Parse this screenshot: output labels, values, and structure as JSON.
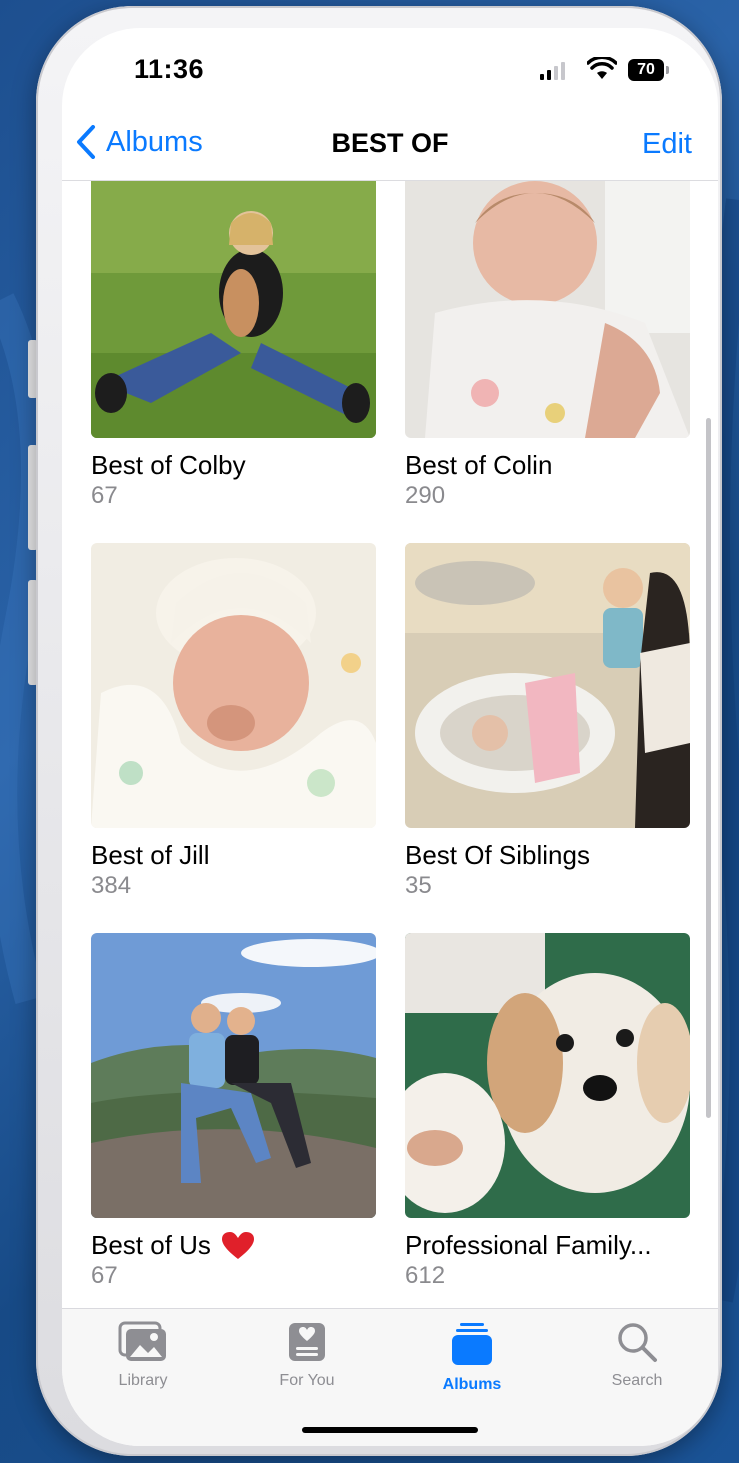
{
  "statusbar": {
    "time": "11:36",
    "battery": "70"
  },
  "nav": {
    "back_label": "Albums",
    "title": "BEST OF",
    "edit_label": "Edit"
  },
  "albums": [
    {
      "name": "Best of Colby",
      "count": "67"
    },
    {
      "name": "Best of Colin",
      "count": "290"
    },
    {
      "name": "Best of Jill",
      "count": "384"
    },
    {
      "name": "Best Of Siblings",
      "count": "35"
    },
    {
      "name": "Best of Us",
      "count": "67",
      "badge_icon": "red-heart-icon"
    },
    {
      "name": "Professional Family...",
      "count": "612"
    }
  ],
  "tabbar": {
    "tabs": [
      {
        "label": "Library",
        "icon": "photo-library-icon"
      },
      {
        "label": "For You",
        "icon": "for-you-icon"
      },
      {
        "label": "Albums",
        "icon": "albums-stack-icon",
        "active": true
      },
      {
        "label": "Search",
        "icon": "search-icon"
      }
    ]
  },
  "colors": {
    "accent": "#0A7AFF",
    "background": "#FFFFFF",
    "secondary_text": "#8A8A8E",
    "heart": "#E0202A"
  }
}
